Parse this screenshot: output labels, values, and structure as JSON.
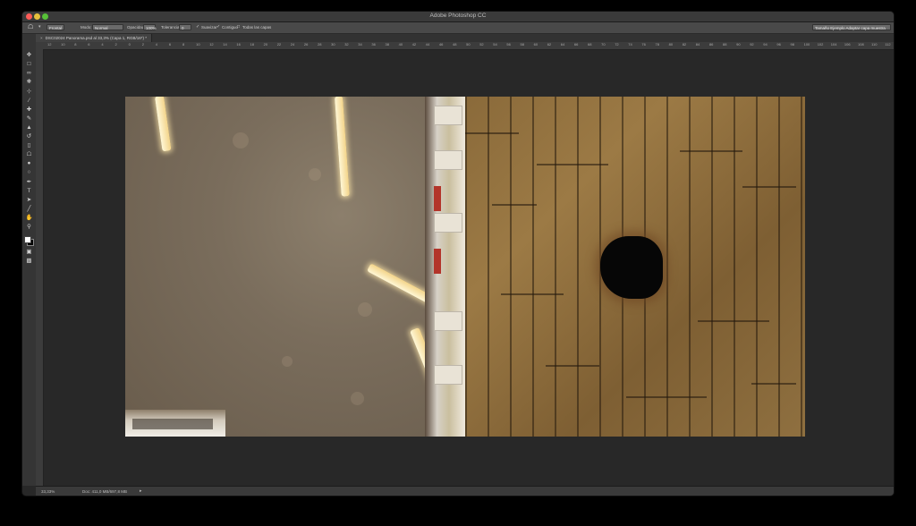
{
  "app": {
    "title": "Adobe Photoshop CC"
  },
  "options_bar": {
    "tool_preset": "Frontal",
    "mode_label": "Modo:",
    "mode_value": "Normal",
    "opacity_label": "Opacidad:",
    "opacity_value": "100%",
    "tolerance_label": "Tolerancia:",
    "tolerance_value": "0",
    "suavizar_label": "Suavizar",
    "contiguo_label": "Contiguo",
    "todas_capas_label": "Todas las capas",
    "workspace_value": "Tamaño Ejemplo Adaptar capa muestra"
  },
  "document": {
    "tab_label": "DSC02024 Panorama.psd al 33,3% (Capa 1, RGB/16*) *"
  },
  "ruler": {
    "labels": [
      "12",
      "10",
      "8",
      "6",
      "4",
      "2",
      "0",
      "2",
      "4",
      "6",
      "8",
      "10",
      "12",
      "14",
      "16",
      "18",
      "20",
      "22",
      "24",
      "26",
      "28",
      "30",
      "32",
      "34",
      "36",
      "38",
      "40",
      "42",
      "44",
      "46",
      "48",
      "50",
      "52",
      "54",
      "56",
      "58",
      "60",
      "62",
      "64",
      "66",
      "68",
      "70",
      "72",
      "74",
      "76",
      "78",
      "80",
      "82",
      "84",
      "86",
      "88",
      "90",
      "92",
      "94",
      "96",
      "98",
      "100",
      "102",
      "104",
      "106",
      "108",
      "110",
      "112"
    ]
  },
  "status": {
    "zoom": "33,33%",
    "doc_size": "Doc: 411,0 MB/697,8 MB"
  },
  "colors": {
    "background": "#282828",
    "panel": "#353535",
    "close": "#fc5b57",
    "minimize": "#e5bf3c",
    "maximize": "#57c038"
  },
  "icons": {
    "tools": [
      "move-icon",
      "marquee-icon",
      "lasso-icon",
      "quick-select-icon",
      "crop-icon",
      "eyedropper-icon",
      "healing-icon",
      "brush-icon",
      "clone-stamp-icon",
      "history-brush-icon",
      "eraser-icon",
      "paint-bucket-icon",
      "blur-icon",
      "dodge-icon",
      "pen-icon",
      "type-icon",
      "path-select-icon",
      "shape-icon",
      "hand-icon",
      "zoom-icon"
    ]
  }
}
